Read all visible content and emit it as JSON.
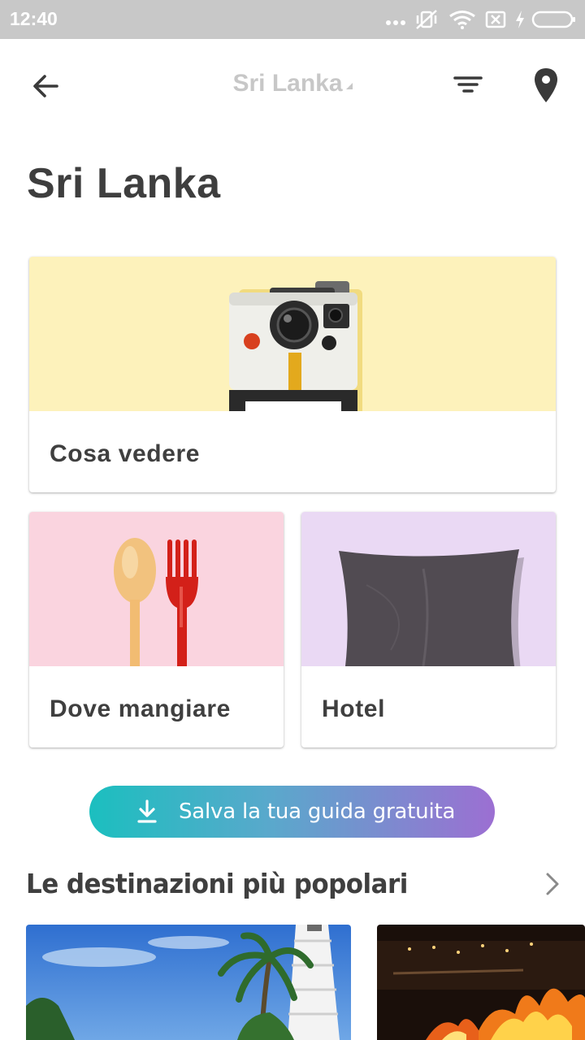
{
  "status_bar": {
    "time": "12:40",
    "icons": [
      "more-dots-icon",
      "vibrate-off-icon",
      "wifi-icon",
      "sim-off-icon",
      "charging-icon",
      "battery-icon"
    ]
  },
  "toolbar": {
    "title": "Sri Lanka",
    "icons": [
      "back-arrow-icon",
      "filter-icon",
      "map-pin-icon"
    ]
  },
  "page": {
    "title": "Sri Lanka"
  },
  "categories": [
    {
      "label": "Cosa vedere",
      "image": "instant-camera",
      "bg": "#fdf2bb"
    },
    {
      "label": "Dove mangiare",
      "image": "spoon-and-fork",
      "bg": "#fad4df"
    },
    {
      "label": "Hotel",
      "image": "pillow",
      "bg": "#ead9f4"
    }
  ],
  "cta": {
    "label": "Salva la tua guida gratuita",
    "icon": "download-icon"
  },
  "popular": {
    "title": "Le destinazioni più popolari",
    "icon": "chevron-right-icon",
    "items": [
      "beach-lighthouse-photo",
      "fire-dance-photo"
    ]
  },
  "colors": {
    "gradient_start": "#1bbfbf",
    "gradient_end": "#9c6fd2",
    "statusbar_bg": "#c8c8c8",
    "text": "#3f3f3f"
  }
}
